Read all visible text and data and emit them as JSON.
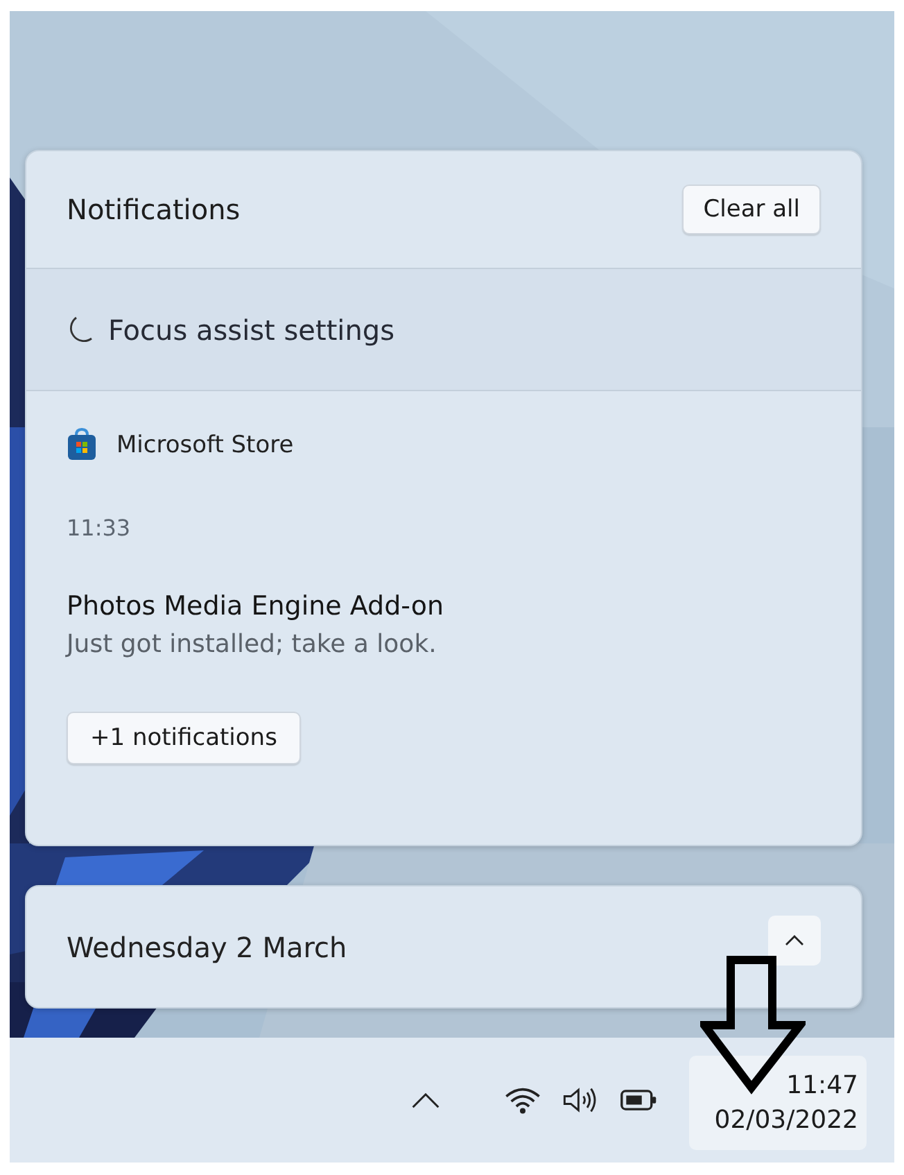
{
  "notifications": {
    "title": "Notifications",
    "clear_button": "Clear all",
    "focus_assist": "Focus assist settings",
    "items": [
      {
        "app": "Microsoft Store",
        "time": "11:33",
        "title": "Photos Media Engine Add-on",
        "body": "Just got installed; take a look.",
        "more_button": "+1 notifications"
      }
    ]
  },
  "calendar": {
    "date": "Wednesday 2 March",
    "expanded": false
  },
  "taskbar": {
    "clock": {
      "time": "11:47",
      "date": "02/03/2022"
    }
  }
}
